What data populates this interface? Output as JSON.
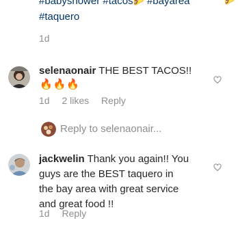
{
  "caption": {
    "line1_tags": [
      "#babyshower",
      "#tacos"
    ],
    "line1_tail": "#bayarea",
    "line2": "#taquero",
    "time": "1d"
  },
  "comments": [
    {
      "username": "selenaonair",
      "text": "THE BEST TACOS!!",
      "emoji": "🔥🔥🔥",
      "time": "1d",
      "likes": "2 likes",
      "reply_label": "Reply"
    },
    {
      "username": "jackwelin",
      "text_lines": [
        "Thank you again!! You",
        "guys are the BEST taquero in",
        "the bay area with great service",
        "and great food !!"
      ],
      "time": "1d",
      "reply_label": "Reply"
    }
  ],
  "reply_prompt": "Reply to selenaonair...",
  "colors": {
    "hashtag": "#003569",
    "text": "#262626",
    "muted": "#8e8e8e"
  },
  "icons": [
    "heart-outline-icon",
    "taco-emoji",
    "fire-emoji"
  ]
}
